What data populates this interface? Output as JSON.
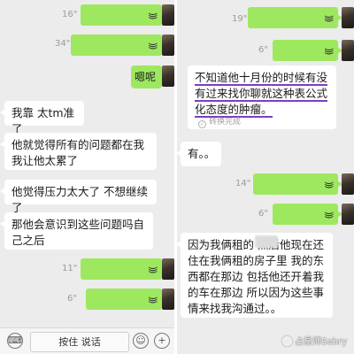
{
  "left": {
    "voice_messages": [
      {
        "duration": "16\""
      },
      {
        "duration": "34\""
      }
    ],
    "sent_text": "嗯呢",
    "received": [
      "我靠 太tm准了",
      "他就觉得所有的问题都在我 我让他太累了",
      "他觉得压力太大了 不想继续了",
      "那他会意识到这些问题吗自己之后"
    ],
    "voice_messages_bottom": [
      {
        "duration": "11\""
      },
      {
        "duration": "6\""
      }
    ],
    "input": {
      "hold_to_talk_label": "按住 说话",
      "emoji_icon": "smiley-icon",
      "plus_icon": "plus-icon"
    }
  },
  "right": {
    "voice_top": {
      "duration": "19\""
    },
    "voice_second": {
      "duration": "6\""
    },
    "transcribed_text": "不知道他十月份的时候有没有过来找你聊就这种表公式化态度的肿瘤。",
    "transcription_status": "转换完成",
    "short_reply": "有。。",
    "voice_third": {
      "duration": "14\""
    },
    "voice_fourth": {
      "duration": "6\""
    },
    "long_text": "因为我俩租的 然后他现在还住在我俩租的房子里 我的东西都在那边 包括他还开着我的车在那边 所以因为这些事情来找我沟通过。。",
    "watermark": "占星师Sebry"
  },
  "colors": {
    "sent_bubble": "#9ee85f",
    "received_bubble": "#ffffff",
    "chat_background": "#ececec",
    "highlight_underline": "#7b3fbf"
  }
}
